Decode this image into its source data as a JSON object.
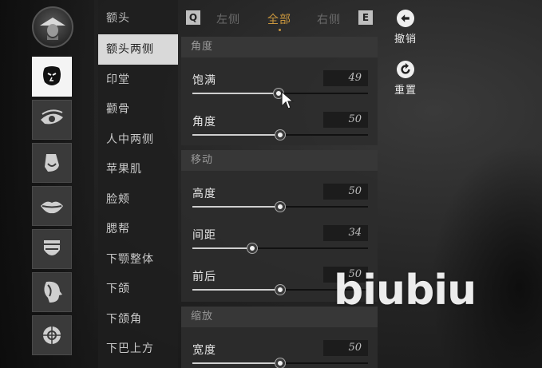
{
  "parts": {
    "active_index": 0,
    "items": [
      {
        "icon": "face-mask-icon"
      },
      {
        "icon": "eye-icon"
      },
      {
        "icon": "nose-icon"
      },
      {
        "icon": "mouth-icon"
      },
      {
        "icon": "jaw-icon"
      },
      {
        "icon": "head-profile-icon"
      },
      {
        "icon": "ear-icon"
      }
    ]
  },
  "subcategories": {
    "header": "额头",
    "items": [
      "额头两侧",
      "印堂",
      "颧骨",
      "人中两侧",
      "苹果肌",
      "脸颊",
      "腮帮",
      "下颚整体",
      "下颌",
      "下颌角",
      "下巴上方"
    ],
    "active": "额头两侧"
  },
  "tabs": {
    "prev_key": "Q",
    "next_key": "E",
    "items": [
      "左侧",
      "全部",
      "右侧"
    ],
    "active": "全部"
  },
  "sections": [
    {
      "title": "角度",
      "rows": [
        {
          "label": "饱满",
          "value": "49",
          "level": 0.49
        },
        {
          "label": "角度",
          "value": "50",
          "level": 0.5
        }
      ]
    },
    {
      "title": "移动",
      "rows": [
        {
          "label": "高度",
          "value": "50",
          "level": 0.5
        },
        {
          "label": "间距",
          "value": "34",
          "level": 0.34
        },
        {
          "label": "前后",
          "value": "50",
          "level": 0.5
        }
      ]
    },
    {
      "title": "缩放",
      "rows": [
        {
          "label": "宽度",
          "value": "50",
          "level": 0.5
        }
      ]
    }
  ],
  "actions": {
    "undo_label": "撤销",
    "reset_label": "重置"
  },
  "watermark": "biubiu",
  "colors": {
    "accent": "#c9963e",
    "active_bg": "#d9d9d9"
  }
}
